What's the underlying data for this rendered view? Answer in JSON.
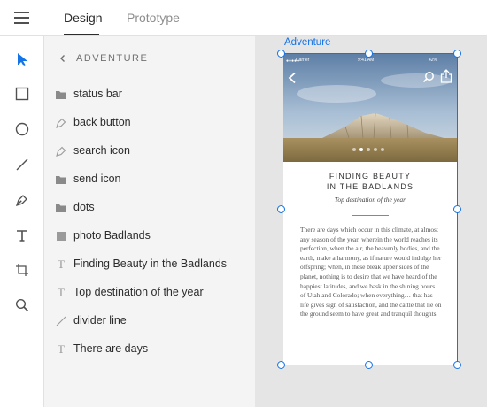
{
  "header": {
    "tabs": [
      {
        "label": "Design",
        "active": true
      },
      {
        "label": "Prototype",
        "active": false
      }
    ]
  },
  "tools": [
    {
      "name": "select-tool",
      "icon": "arrow-pointer-icon",
      "active": true
    },
    {
      "name": "rectangle-tool",
      "icon": "rectangle-icon"
    },
    {
      "name": "ellipse-tool",
      "icon": "ellipse-icon"
    },
    {
      "name": "line-tool",
      "icon": "line-icon"
    },
    {
      "name": "pen-tool",
      "icon": "pen-icon"
    },
    {
      "name": "text-tool",
      "icon": "text-icon"
    },
    {
      "name": "artboard-tool",
      "icon": "artboard-icon"
    },
    {
      "name": "zoom-tool",
      "icon": "magnifier-icon"
    }
  ],
  "layers": {
    "title": "ADVENTURE",
    "items": [
      {
        "label": "status bar",
        "icon": "folder-icon"
      },
      {
        "label": "back button",
        "icon": "pen-path-icon"
      },
      {
        "label": "search icon",
        "icon": "pen-path-icon"
      },
      {
        "label": "send icon",
        "icon": "folder-icon"
      },
      {
        "label": "dots",
        "icon": "folder-icon"
      },
      {
        "label": "photo Badlands",
        "icon": "image-square-icon"
      },
      {
        "label": "Finding Beauty in the Badlands",
        "icon": "text-t-icon"
      },
      {
        "label": "Top destination of the year",
        "icon": "text-t-icon"
      },
      {
        "label": "divider line",
        "icon": "line-icon"
      },
      {
        "label": "There are days",
        "icon": "text-t-icon"
      }
    ]
  },
  "artboard": {
    "label": "Adventure",
    "statusbar": {
      "carrier": "Carrier",
      "time": "9:41 AM",
      "battery": "42%"
    },
    "title_line1": "FINDING BEAUTY",
    "title_line2": "IN THE BADLANDS",
    "subtitle": "Top destination of the year",
    "body": "There are days which occur in this climate, at almost any season of the year, wherein the world reaches its perfection, when the air, the heavenly bodies, and the earth, make a harmony, as if nature would indulge her offspring; when, in these bleak upper sides of the planet, nothing is to desire that we have heard of the happiest latitudes, and we bask in the shining hours of Utah and Colorado; when everything… that has life gives sign of satisfaction, and the cattle that lie on the ground seem to have great and tranquil thoughts.",
    "dots_total": 5,
    "dots_active": 1
  },
  "colors": {
    "accent": "#1473e6",
    "divider": "#29a8e0",
    "panel": "#f4f4f4",
    "canvas": "#e5e5e5"
  }
}
